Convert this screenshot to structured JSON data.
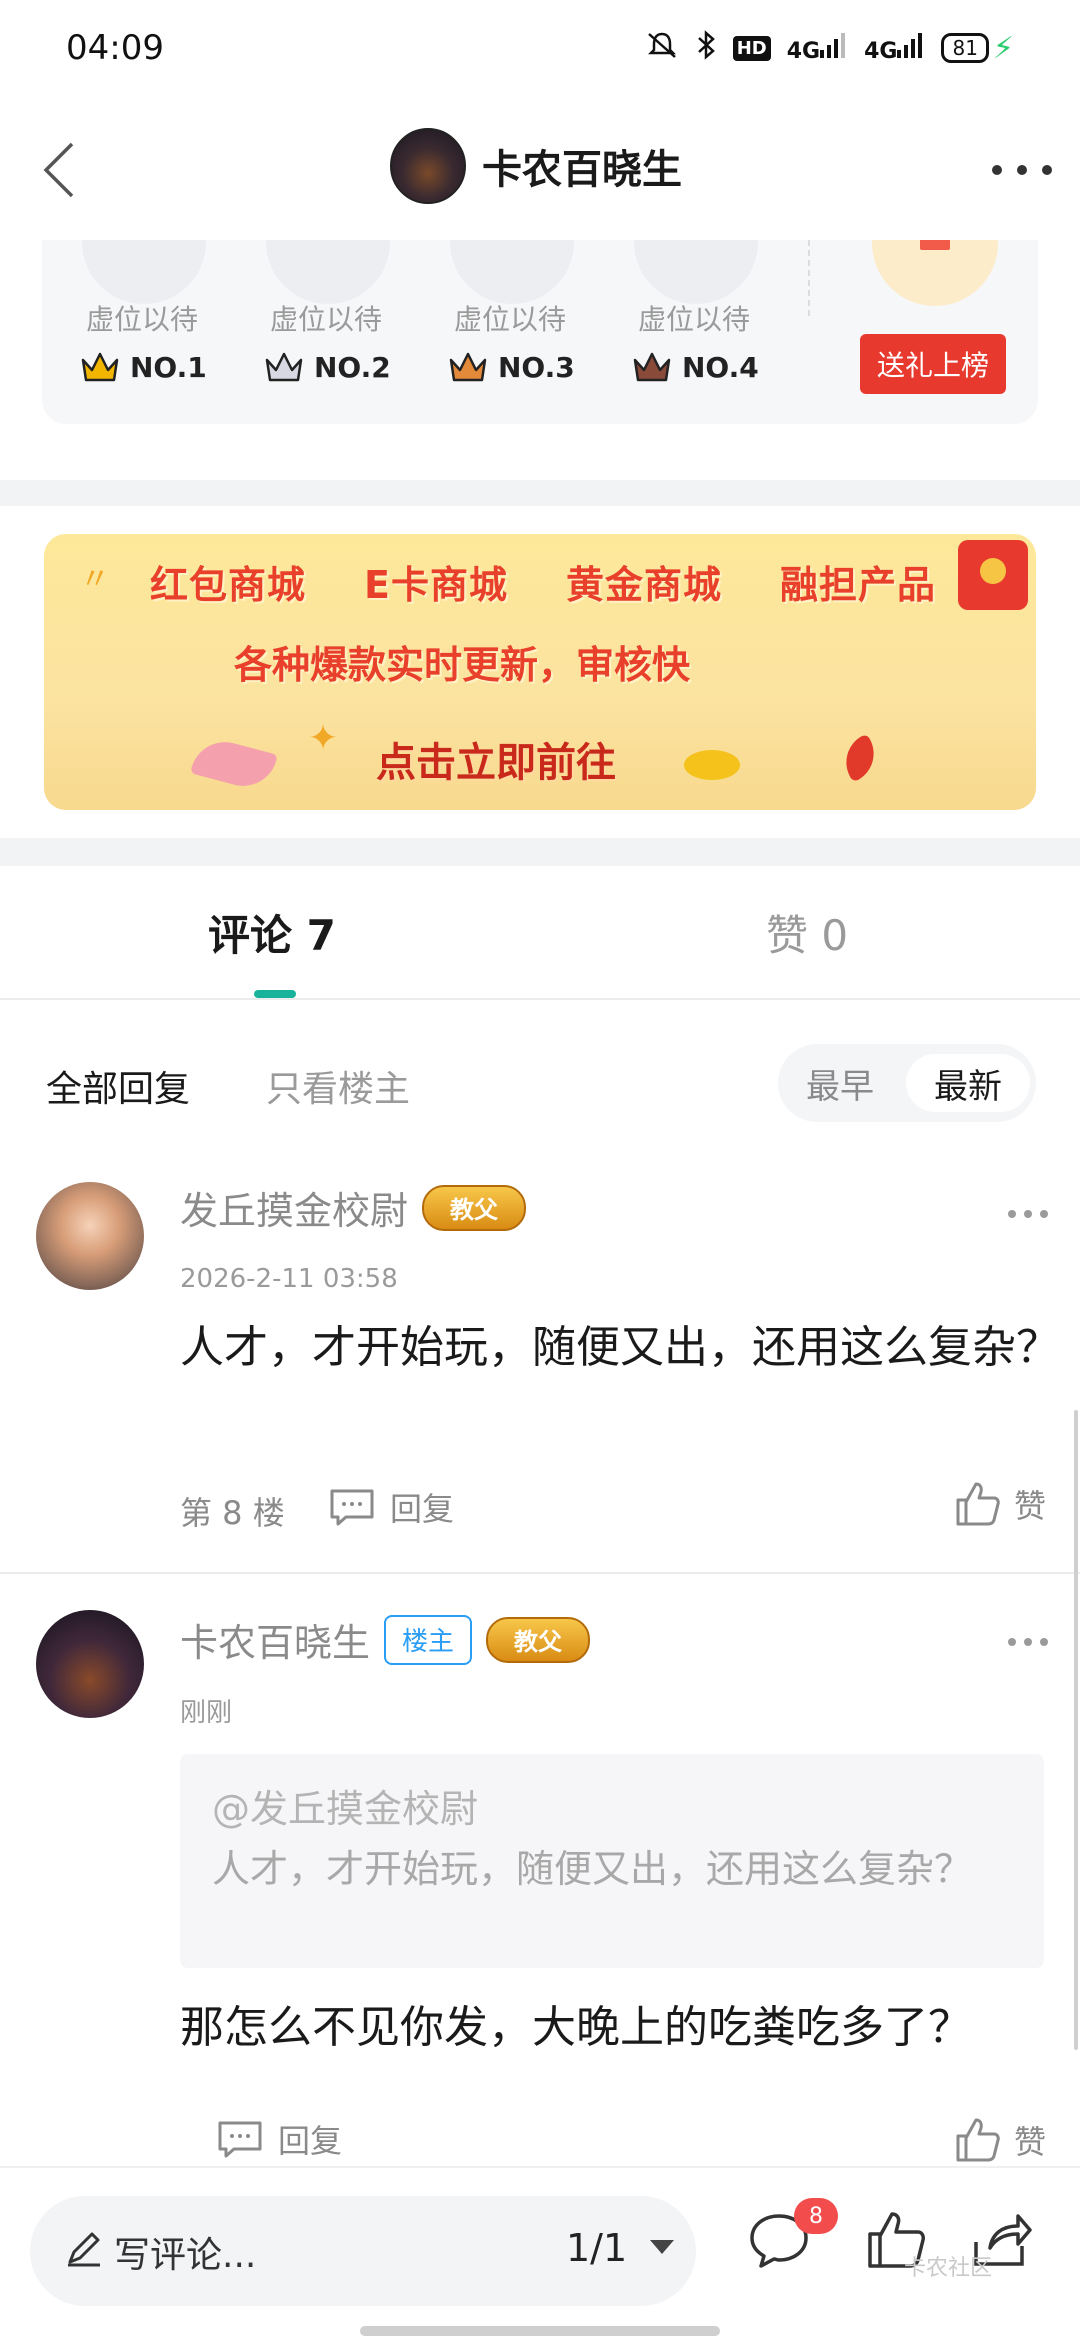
{
  "status_bar": {
    "time": "04:09",
    "network_1": "4G",
    "network_2": "4G",
    "hd": "HD",
    "battery": "81"
  },
  "nav": {
    "title": "卡农百晓生"
  },
  "ranking": {
    "slots": [
      {
        "label": "虚位以待",
        "rank": "NO.1",
        "crown_color": "#f2b600"
      },
      {
        "label": "虚位以待",
        "rank": "NO.2",
        "crown_color": "#c8c8d2"
      },
      {
        "label": "虚位以待",
        "rank": "NO.3",
        "crown_color": "#e28a3a"
      },
      {
        "label": "虚位以待",
        "rank": "NO.4",
        "crown_color": "#8a4a3a"
      }
    ],
    "gift_button": "送礼上榜"
  },
  "banner": {
    "items": [
      "红包商城",
      "E卡商城",
      "黄金商城",
      "融担产品"
    ],
    "subtitle": "各种爆款实时更新，审核快",
    "cta": "点击立即前往"
  },
  "tabs": {
    "comments": "评论 7",
    "likes": "赞 0"
  },
  "filters": {
    "all": "全部回复",
    "op_only": "只看楼主",
    "earliest": "最早",
    "newest": "最新"
  },
  "comments": [
    {
      "author": "发丘摸金校尉",
      "title_tag": "教父",
      "time": "2026-2-11 03:58",
      "text": "人才，才开始玩，随便又出，还用这么复杂？",
      "floor": "第 8 楼",
      "reply_label": "回复",
      "like_label": "赞"
    },
    {
      "author": "卡农百晓生",
      "op_tag": "楼主",
      "title_tag": "教父",
      "time": "刚刚",
      "quote_author": "@发丘摸金校尉",
      "quote_text": "人才，才开始玩，随便又出，还用这么复杂？",
      "text": "那怎么不见你发，大晚上的吃粪吃多了？",
      "reply_label": "回复",
      "like_label": "赞"
    }
  ],
  "bottom_bar": {
    "write_placeholder": "写评论...",
    "page": "1/1",
    "comment_count": "8",
    "watermark": "卡农社区"
  },
  "colors": {
    "accent": "#19b39b",
    "gift_red": "#e8392f",
    "op_blue": "#2a9df4"
  }
}
